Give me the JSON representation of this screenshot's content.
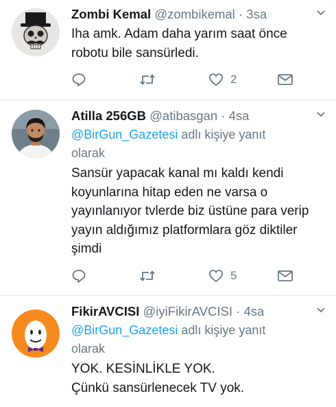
{
  "tweets": [
    {
      "name": "Zombi Kemal",
      "handle": "@zombikemal",
      "separator": "·",
      "time": "3sa",
      "reply_to_prefix": "",
      "reply_to_mention": "",
      "reply_to_suffix": "",
      "text_lines": [
        "Iha amk. Adam daha yarım saat önce",
        "robotu bile sansürledi."
      ],
      "likes": "2"
    },
    {
      "name": "Atilla 256GB",
      "handle": "@atibasgan",
      "separator": "·",
      "time": "4sa",
      "reply_to_mention": "@BirGun_Gazetesi",
      "reply_to_suffix": " adlı kişiye yanıt",
      "reply_to_line2": "olarak",
      "text_lines": [
        "Sansür yapacak kanal mı kaldı kendi",
        "koyunlarına hitap eden ne varsa o",
        "yayınlanıyor tvlerde biz üstüne para verip",
        "yayın aldığımız platformlara göz diktiler",
        "şimdi"
      ],
      "likes": "5"
    },
    {
      "name": "FikirAVCISI",
      "handle": "@iyiFikirAVCISI",
      "separator": "·",
      "time": "4sa",
      "reply_to_mention": "@BirGun_Gazetesi",
      "reply_to_suffix": " adlı kişiye yanıt",
      "reply_to_line2": "olarak",
      "text_lines": [
        "YOK. KESİNLİKLE YOK.",
        "Çünkü sansürlenecek TV yok."
      ]
    }
  ],
  "colors": {
    "link": "#1da1f2",
    "secondary": "#657786",
    "text": "#14171a",
    "divider": "#e1e8ed"
  },
  "icons": [
    "reply-icon",
    "retweet-icon",
    "like-icon",
    "direct-message-icon",
    "caret-down-icon"
  ]
}
